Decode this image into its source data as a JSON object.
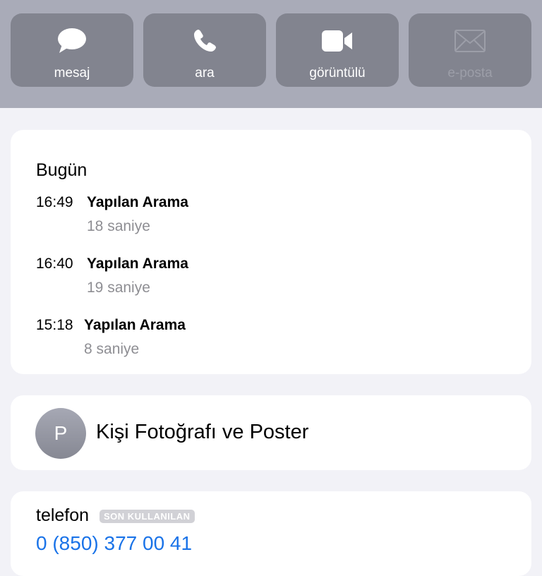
{
  "actions": [
    {
      "label": "mesaj",
      "icon": "message-bubble-icon",
      "enabled": true
    },
    {
      "label": "ara",
      "icon": "phone-icon",
      "enabled": true
    },
    {
      "label": "görüntülü",
      "icon": "video-camera-icon",
      "enabled": true
    },
    {
      "label": "e-posta",
      "icon": "envelope-icon",
      "enabled": false
    }
  ],
  "recents": {
    "day": "Bugün",
    "calls": [
      {
        "time": "16:49",
        "type": "Yapılan Arama",
        "duration": "18 saniye"
      },
      {
        "time": "16:40",
        "type": "Yapılan Arama",
        "duration": "19 saniye"
      },
      {
        "time": "15:18",
        "type": "Yapılan Arama",
        "duration": "8 saniye"
      }
    ]
  },
  "poster": {
    "avatar_initial": "P",
    "title": "Kişi Fotoğrafı ve Poster"
  },
  "phone": {
    "label": "telefon",
    "badge": "SON KULLANILAN",
    "number": "0 (850) 377 00 41"
  },
  "colors": {
    "header_bg": "#a9abb8",
    "button_bg": "#82848f",
    "link": "#1a73e8",
    "secondary_text": "#8e8e93"
  }
}
